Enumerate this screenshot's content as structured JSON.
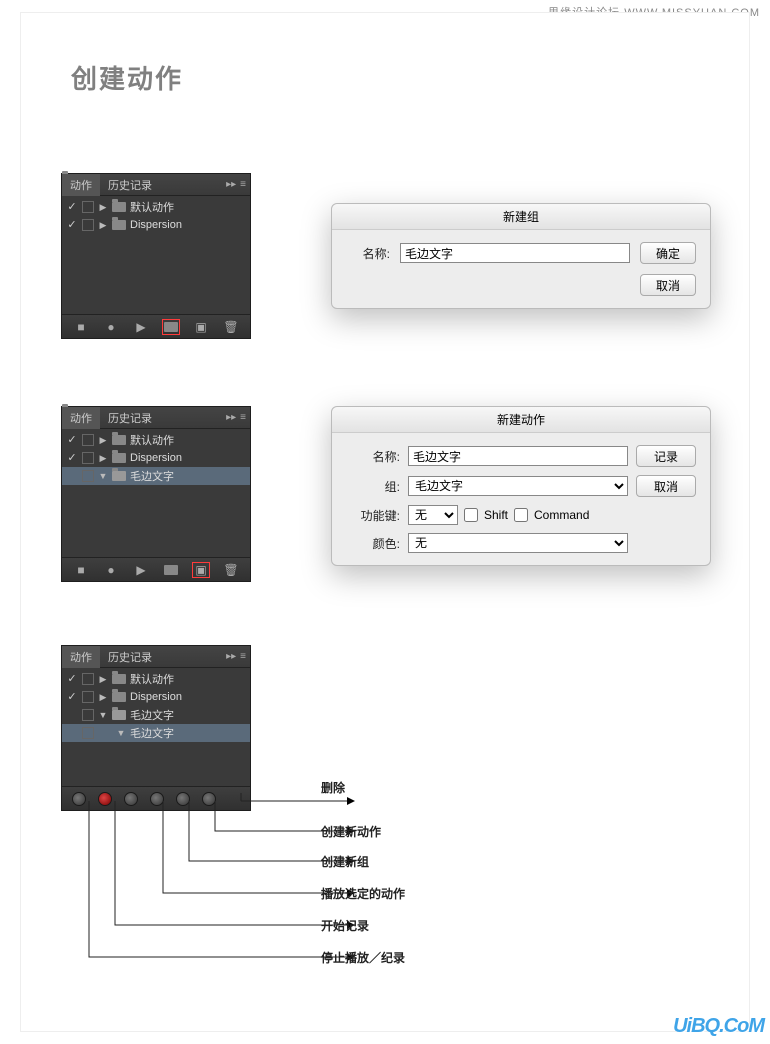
{
  "header_right": "思缘设计论坛  WWW.MISSYUAN.COM",
  "title": "创建动作",
  "panel_tabs": {
    "actions": "动作",
    "history": "历史记录"
  },
  "actions1": {
    "rows": [
      "默认动作",
      "Dispersion"
    ]
  },
  "actions2": {
    "rows": [
      "默认动作",
      "Dispersion",
      "毛边文字"
    ]
  },
  "actions3": {
    "rows": [
      "默认动作",
      "Dispersion",
      "毛边文字",
      "毛边文字"
    ]
  },
  "newgroup": {
    "title": "新建组",
    "name_label": "名称:",
    "name_value": "毛边文字",
    "ok": "确定",
    "cancel": "取消"
  },
  "newaction": {
    "title": "新建动作",
    "name_label": "名称:",
    "name_value": "毛边文字",
    "group_label": "组:",
    "group_value": "毛边文字",
    "fn_label": "功能键:",
    "fn_value": "无",
    "shift": "Shift",
    "command": "Command",
    "color_label": "颜色:",
    "color_value": "无",
    "record": "记录",
    "cancel": "取消"
  },
  "callouts": {
    "delete": "删除",
    "new_action": "创建新动作",
    "new_group": "创建新组",
    "play": "播放选定的动作",
    "record": "开始记录",
    "stop": "停止播放／纪录"
  },
  "watermark": "UiBQ.CoM"
}
